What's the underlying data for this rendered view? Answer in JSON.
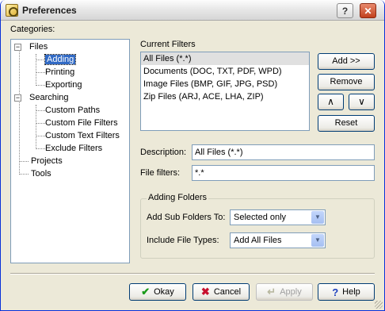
{
  "window": {
    "title": "Preferences"
  },
  "categories_label": "Categories:",
  "tree": {
    "items": [
      {
        "label": "Files"
      },
      {
        "label": "Adding"
      },
      {
        "label": "Printing"
      },
      {
        "label": "Exporting"
      },
      {
        "label": "Searching"
      },
      {
        "label": "Custom Paths"
      },
      {
        "label": "Custom File Filters"
      },
      {
        "label": "Custom Text Filters"
      },
      {
        "label": "Exclude Filters"
      },
      {
        "label": "Projects"
      },
      {
        "label": "Tools"
      }
    ],
    "selected": "Adding"
  },
  "current_filters": {
    "label": "Current Filters",
    "items": [
      "All Files (*.*)",
      "Documents (DOC, TXT, PDF, WPD)",
      "Image Files (BMP, GIF, JPG, PSD)",
      "Zip Files (ARJ, ACE, LHA, ZIP)"
    ]
  },
  "buttons": {
    "add": "Add >>",
    "remove": "Remove",
    "up": "∧",
    "down": "∨",
    "reset": "Reset"
  },
  "description": {
    "label": "Description:",
    "value": "All Files (*.*)"
  },
  "file_filters": {
    "label": "File filters:",
    "value": "*.*"
  },
  "adding_folders": {
    "title": "Adding Folders",
    "add_sub_folders_label": "Add Sub Folders To:",
    "add_sub_folders_value": "Selected only",
    "include_types_label": "Include File Types:",
    "include_types_value": "Add All Files"
  },
  "footer": {
    "ok": "Okay",
    "cancel": "Cancel",
    "apply": "Apply",
    "help": "Help"
  }
}
